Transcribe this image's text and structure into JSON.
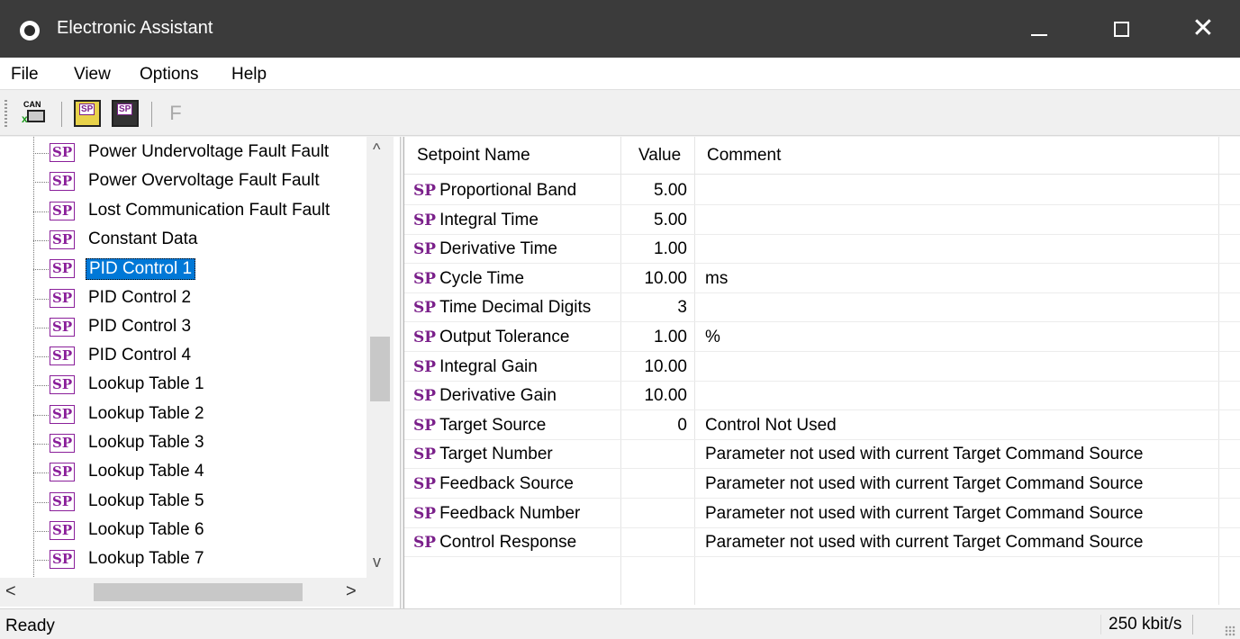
{
  "window": {
    "title": "Electronic Assistant",
    "minimize": "",
    "maximize": "",
    "close": "✕"
  },
  "menu": [
    "File",
    "View",
    "Options",
    "Help"
  ],
  "toolbar": {
    "can_icon_text": "CAN",
    "sp_icon_text": "SP",
    "f_button": "F"
  },
  "tree": {
    "badge": "SP",
    "items": [
      "Power Undervoltage Fault Fault",
      "Power Overvoltage Fault Fault",
      "Lost Communication Fault Fault",
      "Constant Data",
      "PID Control 1",
      "PID Control 2",
      "PID Control 3",
      "PID Control 4",
      "Lookup Table 1",
      "Lookup Table 2",
      "Lookup Table 3",
      "Lookup Table 4",
      "Lookup Table 5",
      "Lookup Table 6",
      "Lookup Table 7"
    ],
    "selected": "PID Control 1"
  },
  "grid": {
    "headers": {
      "name": "Setpoint Name",
      "value": "Value",
      "comment": "Comment"
    },
    "prefix": "SP",
    "rows": [
      {
        "name": "Proportional Band",
        "value": "5.00",
        "comment": ""
      },
      {
        "name": "Integral Time",
        "value": "5.00",
        "comment": ""
      },
      {
        "name": "Derivative Time",
        "value": "1.00",
        "comment": ""
      },
      {
        "name": "Cycle Time",
        "value": "10.00",
        "comment": "ms"
      },
      {
        "name": "Time Decimal Digits",
        "value": "3",
        "comment": ""
      },
      {
        "name": "Output Tolerance",
        "value": "1.00",
        "comment": "%"
      },
      {
        "name": "Integral Gain",
        "value": "10.00",
        "comment": ""
      },
      {
        "name": "Derivative Gain",
        "value": "10.00",
        "comment": ""
      },
      {
        "name": "Target Source",
        "value": "0",
        "comment": "Control Not Used"
      },
      {
        "name": "Target Number",
        "value": "",
        "comment": "Parameter not used with current Target Command Source"
      },
      {
        "name": "Feedback Source",
        "value": "",
        "comment": "Parameter not used with current Target Command Source"
      },
      {
        "name": "Feedback Number",
        "value": "",
        "comment": "Parameter not used with current Target Command Source"
      },
      {
        "name": "Control Response",
        "value": "",
        "comment": "Parameter not used with current Target Command Source"
      }
    ]
  },
  "status": {
    "text": "Ready",
    "baud": "250 kbit/s"
  }
}
